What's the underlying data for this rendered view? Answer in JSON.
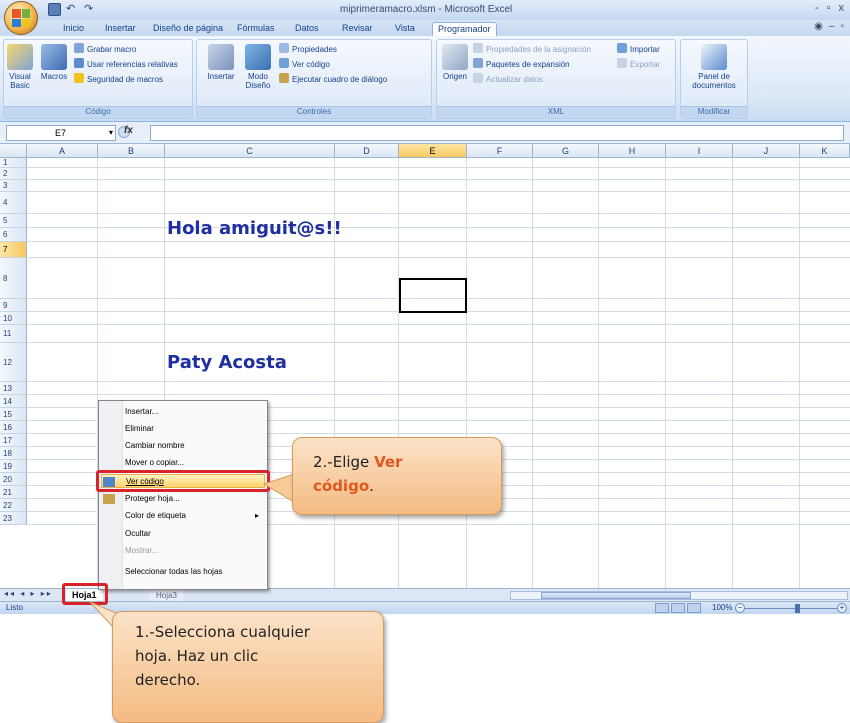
{
  "window": {
    "title": "miprimeramacro.xlsm - Microsoft Excel",
    "controls": [
      "-",
      "▫",
      "x"
    ]
  },
  "ribbon": {
    "tabs": [
      "Inicio",
      "Insertar",
      "Diseño de página",
      "Fórmulas",
      "Datos",
      "Revisar",
      "Vista",
      "Programador"
    ],
    "active_tab": "Programador",
    "groups": {
      "codigo": {
        "label": "Código",
        "vb": "Visual Basic",
        "macros": "Macros",
        "grabar": "Grabar macro",
        "referencias": "Usar referencias relativas",
        "seguridad": "Seguridad de macros"
      },
      "controles": {
        "label": "Controles",
        "insertar": "Insertar",
        "modo_diseno": "Modo Diseño",
        "propiedades": "Propiedades",
        "ver_codigo": "Ver código",
        "ejecutar": "Ejecutar cuadro de diálogo"
      },
      "xml": {
        "label": "XML",
        "origen": "Origen",
        "propiedades_asignacion": "Propiedades de la asignación",
        "paquetes": "Paquetes de expansión",
        "actualizar": "Actualizar datos",
        "importar": "Importar",
        "exportar": "Exportar"
      },
      "modificar": {
        "label": "Modificar",
        "panel": "Panel de documentos"
      }
    }
  },
  "formula_bar": {
    "name_box": "E7",
    "fx": "fx",
    "value": ""
  },
  "grid": {
    "columns": [
      "A",
      "B",
      "C",
      "D",
      "E",
      "F",
      "G",
      "H",
      "I",
      "J",
      "K"
    ],
    "selected_column": "E",
    "rows": [
      "1",
      "2",
      "3",
      "4",
      "5",
      "6",
      "7",
      "8",
      "9",
      "10",
      "11",
      "12",
      "13",
      "14",
      "15",
      "16",
      "17",
      "18",
      "19",
      "20",
      "21",
      "22",
      "23"
    ],
    "selected_row": "7",
    "cells": {
      "C4": "Hola amiguit@s!!",
      "C10": "Paty Acosta"
    }
  },
  "sheet_tabs": {
    "active": "Hoja1",
    "others": [
      "Hoja3"
    ]
  },
  "status": {
    "text": "Listo",
    "zoom": "100%"
  },
  "context_menu": {
    "items": [
      {
        "label": "Insertar...",
        "enabled": true
      },
      {
        "label": "Eliminar",
        "enabled": true
      },
      {
        "label": "Cambiar nombre",
        "enabled": true
      },
      {
        "label": "Mover o copiar...",
        "enabled": true
      },
      {
        "label": "Ver código",
        "enabled": true,
        "highlighted": true
      },
      {
        "label": "Proteger hoja...",
        "enabled": true
      },
      {
        "label": "Color de etiqueta",
        "enabled": true,
        "submenu": true
      },
      {
        "label": "Ocultar",
        "enabled": true
      },
      {
        "label": "Mostrar...",
        "enabled": false
      },
      {
        "label": "Seleccionar todas las hojas",
        "enabled": true
      }
    ]
  },
  "callouts": {
    "step2_prefix": "2.-Elige ",
    "step2_word1": "Ver",
    "step2_word2": "código",
    "step2_suffix": ".",
    "step1_line1": "1.-Selecciona cualquier",
    "step1_line2": "hoja.  Haz un clic",
    "step1_line3": "derecho."
  },
  "colors": {
    "accent_red": "#d9222a",
    "callout_orange": "#f4bb82",
    "highlight_text": "#e0571f",
    "cell_text": "#1f2fa0"
  }
}
